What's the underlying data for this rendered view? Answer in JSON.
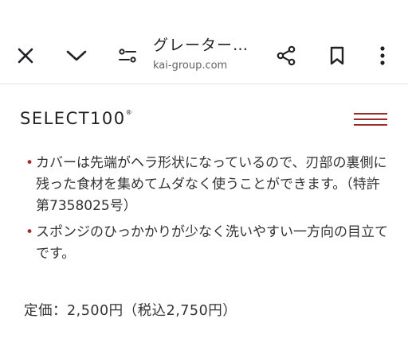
{
  "browser": {
    "title": "グレーター…",
    "url": "kai-group.com",
    "icons": [
      "close-icon",
      "chevron-down-icon",
      "site-settings-icon",
      "share-icon",
      "bookmark-icon",
      "more-vert-icon"
    ]
  },
  "brand": {
    "name": "SELECT100",
    "accent_color": "#9b2a2a"
  },
  "features": [
    "カバーは先端がヘラ形状になっているので、刃部の裏側に残った食材を集めてムダなく使うことができます。（特許第7358025号）",
    "スポンジのひっかかりが少なく洗いやすい一方向の目立てです。"
  ],
  "price": "定価：2,500円（税込2,750円）"
}
